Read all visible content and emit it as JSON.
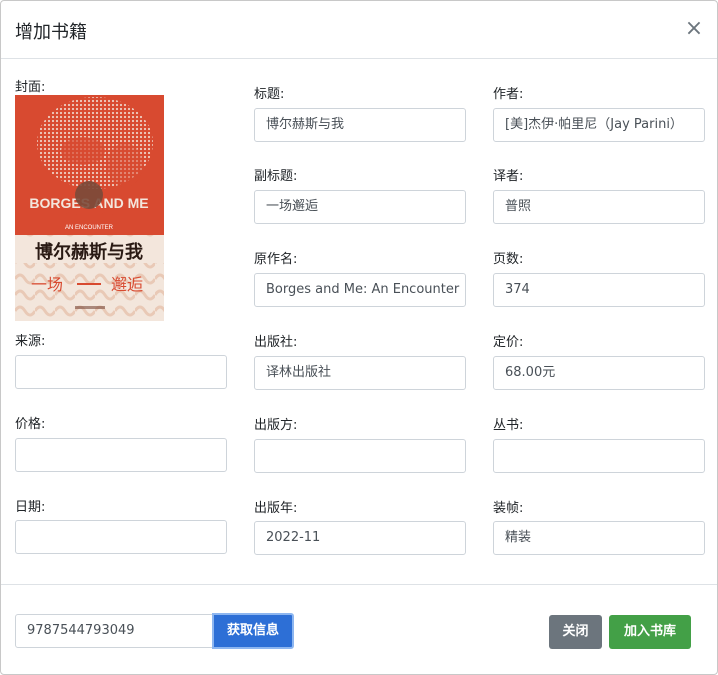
{
  "modal": {
    "title": "增加书籍",
    "close_symbol": "×"
  },
  "form": {
    "cover_label": "封面:",
    "fields": {
      "title": {
        "label": "标题:",
        "value": "博尔赫斯与我"
      },
      "author": {
        "label": "作者:",
        "value": "[美]杰伊·帕里尼（Jay Parini）"
      },
      "subtitle": {
        "label": "副标题:",
        "value": "一场邂逅"
      },
      "translator": {
        "label": "译者:",
        "value": "普照"
      },
      "original_title": {
        "label": "原作名:",
        "value": "Borges and Me: An Encounter"
      },
      "pages": {
        "label": "页数:",
        "value": "374"
      },
      "source": {
        "label": "来源:",
        "value": ""
      },
      "publisher": {
        "label": "出版社:",
        "value": "译林出版社"
      },
      "list_price": {
        "label": "定价:",
        "value": "68.00元"
      },
      "price": {
        "label": "价格:",
        "value": ""
      },
      "producer": {
        "label": "出版方:",
        "value": ""
      },
      "series": {
        "label": "丛书:",
        "value": ""
      },
      "date": {
        "label": "日期:",
        "value": ""
      },
      "pub_year": {
        "label": "出版年:",
        "value": "2022-11"
      },
      "binding": {
        "label": "装帧:",
        "value": "精装"
      }
    }
  },
  "cover": {
    "title_cn": "博尔赫斯与我",
    "title_en": "BORGES AND ME",
    "subtitle_en": "AN ENCOUNTER",
    "subtitle_cn_a": "一场",
    "subtitle_cn_b": "邂逅",
    "colors": {
      "red": "#d84a30",
      "cream": "#f3e6dc",
      "brown": "#7a4a3a"
    }
  },
  "footer": {
    "isbn_value": "9787544793049",
    "fetch_label": "获取信息",
    "close_label": "关闭",
    "add_label": "加入书库"
  },
  "colors": {
    "primary": "#2d6fd6",
    "secondary": "#6c757d",
    "success": "#43a047"
  }
}
